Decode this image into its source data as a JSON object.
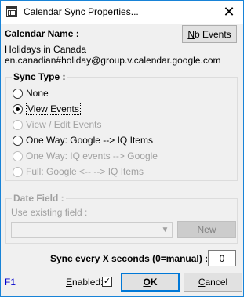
{
  "window": {
    "title": "Calendar Sync Properties...",
    "close_glyph": "✕"
  },
  "calendar": {
    "label": "Calendar Name :",
    "name": "Holidays in Canada",
    "address": "en.canadian#holiday@group.v.calendar.google.com",
    "events_button": {
      "prefix": "N",
      "rest": "b Events"
    }
  },
  "sync_type": {
    "title": "Sync Type :",
    "options": [
      {
        "label": "None",
        "checked": false,
        "enabled": true
      },
      {
        "label": "View Events",
        "checked": true,
        "enabled": true
      },
      {
        "label": "View / Edit Events",
        "checked": false,
        "enabled": false
      },
      {
        "label": "One Way: Google --> IQ Items",
        "checked": false,
        "enabled": true
      },
      {
        "label": "One Way: IQ events --> Google",
        "checked": false,
        "enabled": false
      },
      {
        "label": "Full: Google <-- --> IQ Items",
        "checked": false,
        "enabled": false
      }
    ]
  },
  "date_field": {
    "title": "Date Field :",
    "use_existing_label": "Use existing field :",
    "combo_value": "",
    "new_button": {
      "prefix": "N",
      "rest": "ew"
    }
  },
  "sync_interval": {
    "label": "Sync every X seconds (0=manual) :",
    "value": "0"
  },
  "footer": {
    "help_hint": "F1",
    "enabled": {
      "prefix": "E",
      "rest": "nabled:",
      "checked": true,
      "check_glyph": "✓"
    },
    "ok_button": {
      "prefix": "O",
      "rest": "K"
    },
    "cancel_button": {
      "prefix": "C",
      "rest": "ancel"
    }
  },
  "colors": {
    "accent": "#0078d7",
    "help_hint": "#0000cc",
    "disabled_text": "#a0a0a0"
  }
}
